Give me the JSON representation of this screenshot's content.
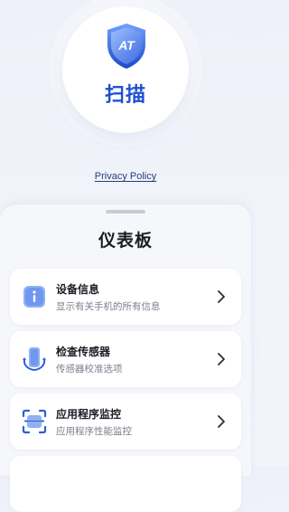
{
  "scan": {
    "label": "扫描",
    "shield_text": "AT"
  },
  "privacy": {
    "link_label": "Privacy Policy"
  },
  "dashboard": {
    "title": "仪表板",
    "items": [
      {
        "title": "设备信息",
        "subtitle": "显示有关手机的所有信息",
        "icon": "info-icon"
      },
      {
        "title": "检查传感器",
        "subtitle": "传感器校准选项",
        "icon": "sensor-icon"
      },
      {
        "title": "应用程序监控",
        "subtitle": "应用程序性能监控",
        "icon": "app-monitor-icon"
      }
    ]
  },
  "colors": {
    "accent": "#1f4fd1",
    "icon_blue": "#3f6fe0",
    "icon_light": "#8fb0f5"
  }
}
